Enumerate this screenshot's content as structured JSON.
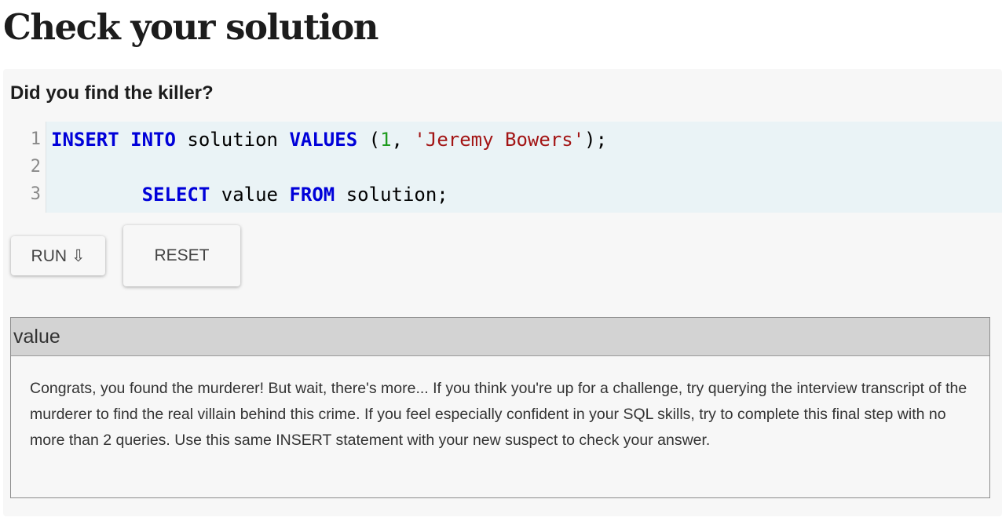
{
  "page": {
    "title": "Check your solution"
  },
  "panel": {
    "heading": "Did you find the killer?"
  },
  "editor": {
    "line_numbers": [
      "1",
      "2",
      "3"
    ],
    "line1": {
      "kw1": "INSERT",
      "kw2": "INTO",
      "ident": " solution ",
      "kw3": "VALUES",
      "open": " (",
      "num": "1",
      "comma": ", ",
      "str": "'Jeremy Bowers'",
      "close": ");"
    },
    "line3": {
      "indent": "        ",
      "kw1": "SELECT",
      "ident1": " value ",
      "kw2": "FROM",
      "ident2": " solution;"
    }
  },
  "buttons": {
    "run_label": "RUN ⇩",
    "reset_label": "RESET"
  },
  "results": {
    "columns": [
      "value"
    ],
    "rows": [
      [
        "Congrats, you found the murderer! But wait, there's more... If you think you're up for a challenge, try querying the interview transcript of the murderer to find the real villain behind this crime. If you feel especially confident in your SQL skills, try to complete this final step with no more than 2 queries. Use this same INSERT statement with your new suspect to check your answer."
      ]
    ]
  },
  "colors": {
    "keyword": "#0000d9",
    "number": "#1e9b1e",
    "string": "#a31515",
    "editor_background": "#eaf3f6",
    "panel_background": "#f7f7f7",
    "table_header_background": "#d3d3d3"
  }
}
